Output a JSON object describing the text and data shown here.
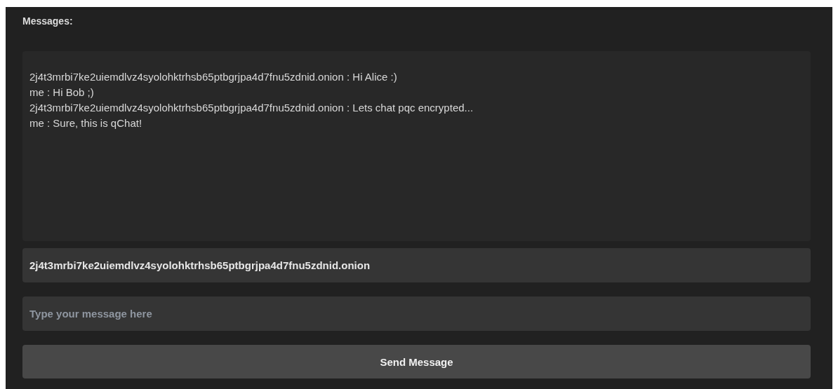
{
  "heading": "Messages:",
  "messages": [
    {
      "text": "2j4t3mrbi7ke2uiemdlvz4syolohktrhsb65ptbgrjpa4d7fnu5zdnid.onion : Hi Alice :)"
    },
    {
      "text": "me : Hi Bob ;)"
    },
    {
      "text": "2j4t3mrbi7ke2uiemdlvz4syolohktrhsb65ptbgrjpa4d7fnu5zdnid.onion : Lets chat pqc encrypted..."
    },
    {
      "text": "me : Sure, this is qChat!"
    }
  ],
  "address_field": {
    "value": "2j4t3mrbi7ke2uiemdlvz4syolohktrhsb65ptbgrjpa4d7fnu5zdnid.onion"
  },
  "message_field": {
    "placeholder": "Type your message here"
  },
  "send_button": {
    "label": "Send Message"
  }
}
